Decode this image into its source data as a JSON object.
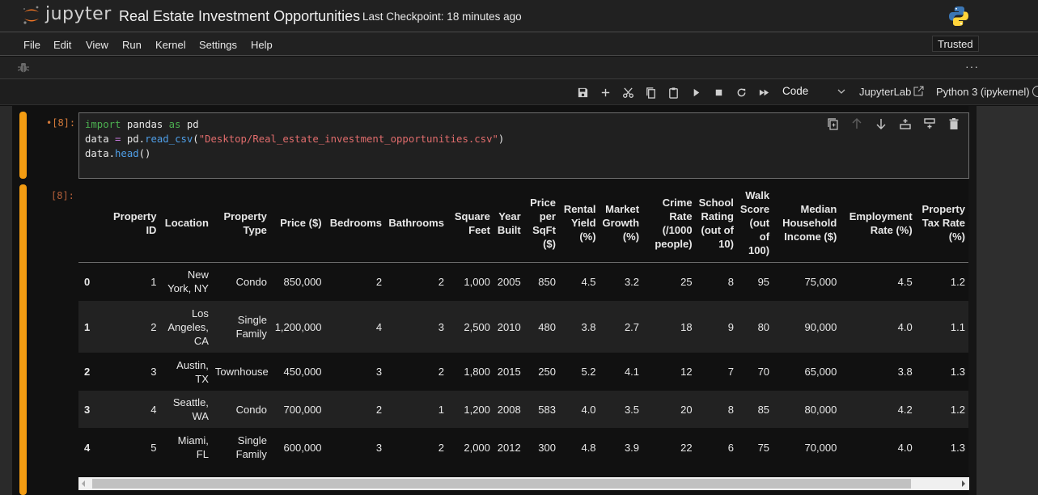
{
  "header": {
    "logo_text": "jupyter",
    "notebook_title": "Real Estate Investment Opportunities",
    "checkpoint": "Last Checkpoint: 18 minutes ago",
    "kernel_logo_icon": "python-logo-icon"
  },
  "menubar": {
    "items": [
      "File",
      "Edit",
      "View",
      "Run",
      "Kernel",
      "Settings",
      "Help"
    ],
    "trusted_label": "Trusted"
  },
  "debugbar": {
    "more_label": "···"
  },
  "toolbar": {
    "icons": [
      "save-icon",
      "add-cell-icon",
      "cut-icon",
      "copy-icon",
      "paste-icon",
      "run-icon",
      "stop-icon",
      "restart-icon",
      "run-all-icon"
    ],
    "cell_type": "Code",
    "jupyterlab_link": "JupyterLab",
    "kernel_name": "Python 3 (ipykernel)"
  },
  "cell": {
    "input_prompt": "•[8]:",
    "output_prompt": "[8]:",
    "code_lines": [
      "import pandas as pd",
      "data = pd.read_csv(\"Desktop/Real_estate_investment_opportunities.csv\")",
      "data.head()"
    ],
    "cell_tool_icons": [
      "duplicate-icon",
      "move-up-icon",
      "move-down-icon",
      "insert-above-icon",
      "insert-below-icon",
      "delete-icon"
    ]
  },
  "dataframe": {
    "columns": [
      "Property ID",
      "Location",
      "Property Type",
      "Price ($)",
      "Bedrooms",
      "Bathrooms",
      "Square Feet",
      "Year Built",
      "Price per SqFt ($)",
      "Rental Yield (%)",
      "Market Growth (%)",
      "Crime Rate (/1000 people)",
      "School Rating (out of 10)",
      "Walk Score (out of 100)",
      "Median Household Income ($)",
      "Employment Rate (%)",
      "Property Tax Rate (%)"
    ],
    "rows": [
      {
        "index": "0",
        "cells": [
          "1",
          "New York, NY",
          "Condo",
          "850,000",
          "2",
          "2",
          "1,000",
          "2005",
          "850",
          "4.5",
          "3.2",
          "25",
          "8",
          "95",
          "75,000",
          "4.5",
          "1.2"
        ]
      },
      {
        "index": "1",
        "cells": [
          "2",
          "Los Angeles, CA",
          "Single Family",
          "1,200,000",
          "4",
          "3",
          "2,500",
          "2010",
          "480",
          "3.8",
          "2.7",
          "18",
          "9",
          "80",
          "90,000",
          "4.0",
          "1.1"
        ]
      },
      {
        "index": "2",
        "cells": [
          "3",
          "Austin, TX",
          "Townhouse",
          "450,000",
          "3",
          "2",
          "1,800",
          "2015",
          "250",
          "5.2",
          "4.1",
          "12",
          "7",
          "70",
          "65,000",
          "3.8",
          "1.3"
        ]
      },
      {
        "index": "3",
        "cells": [
          "4",
          "Seattle, WA",
          "Condo",
          "700,000",
          "2",
          "1",
          "1,200",
          "2008",
          "583",
          "4.0",
          "3.5",
          "20",
          "8",
          "85",
          "80,000",
          "4.2",
          "1.2"
        ]
      },
      {
        "index": "4",
        "cells": [
          "5",
          "Miami, FL",
          "Single Family",
          "600,000",
          "3",
          "2",
          "2,000",
          "2012",
          "300",
          "4.8",
          "3.9",
          "22",
          "6",
          "75",
          "70,000",
          "4.0",
          "1.3"
        ]
      }
    ]
  },
  "colors": {
    "accent_active_cell": "#f39c12",
    "prompt": "#d47a3a",
    "keyword": "#4caf50",
    "function": "#4f9fe8",
    "string": "#e06c6c"
  }
}
